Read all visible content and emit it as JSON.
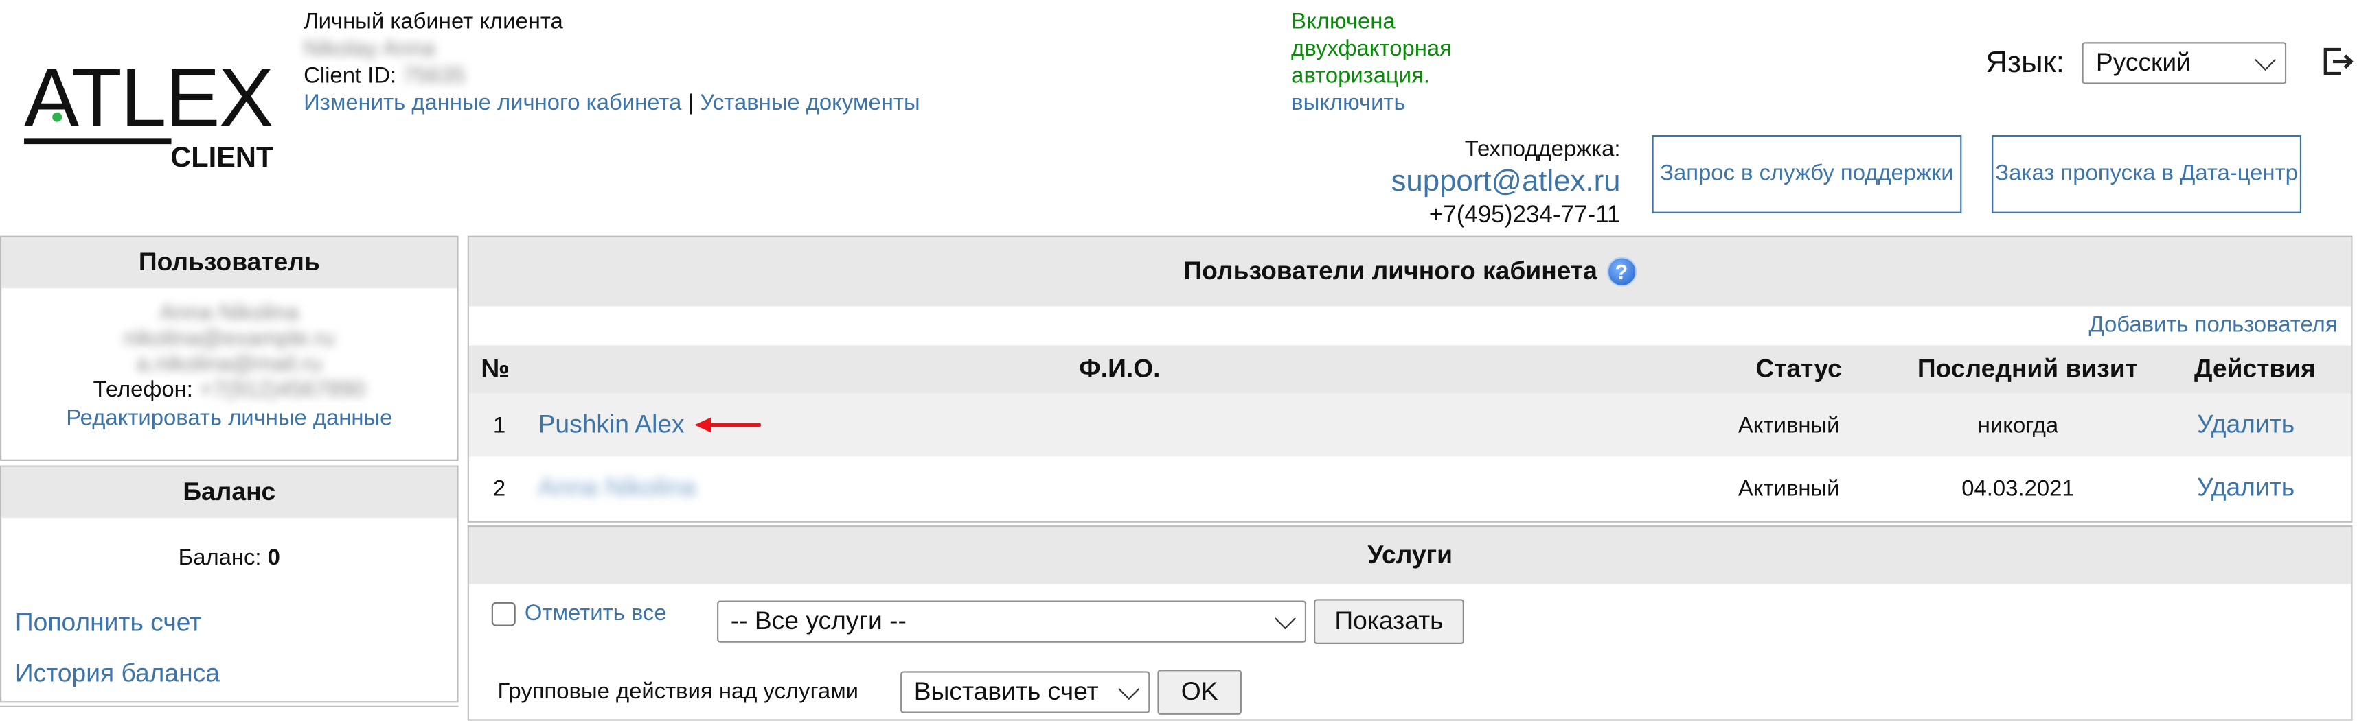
{
  "header": {
    "logo_main": "ATLEX",
    "logo_sub": "CLIENT",
    "cabinet_title": "Личный кабинет клиента",
    "client_name": "Nikolay Anna",
    "client_id_label": "Client ID:",
    "client_id_value": "75635",
    "edit_cabinet_link": "Изменить данные личного кабинета",
    "link_separator": "|",
    "statutory_docs_link": "Уставные документы",
    "twofa_line1": "Включена",
    "twofa_line2": "двухфакторная",
    "twofa_line3": "авторизация.",
    "twofa_disable_link": "выключить",
    "language_label": "Язык:",
    "language_value": "Русский",
    "support_label": "Техподдержка:",
    "support_email": "support@atlex.ru",
    "support_phone": "+7(495)234-77-11",
    "support_request_button": "Запрос в службу поддержки",
    "datacenter_pass_button": "Заказ пропуска в Дата-центр"
  },
  "user_panel": {
    "title": "Пользователь",
    "blurred_line1": "Anna Nikolina",
    "blurred_line2": "nikolina@example.ru",
    "blurred_line3": "a.nikolina@mail.ru",
    "phone_label": "Телефон:",
    "phone_value": "+7(912)4567890",
    "edit_link": "Редактировать личные данные"
  },
  "balance_panel": {
    "title": "Баланс",
    "balance_label": "Баланс:",
    "balance_value": "0",
    "topup_link": "Пополнить счет",
    "history_link": "История баланса"
  },
  "users_panel": {
    "title": "Пользователи личного кабинета",
    "help_glyph": "?",
    "add_user_link": "Добавить пользователя",
    "columns": {
      "num": "№",
      "name": "Ф.И.О.",
      "status": "Статус",
      "last_visit": "Последний визит",
      "actions": "Действия"
    },
    "rows": [
      {
        "num": "1",
        "name": "Pushkin Alex",
        "status": "Активный",
        "last_visit": "никогда",
        "action": "Удалить"
      },
      {
        "num": "2",
        "name": "Anna Nikolina",
        "status": "Активный",
        "last_visit": "04.03.2021",
        "action": "Удалить"
      }
    ]
  },
  "services_panel": {
    "title": "Услуги",
    "select_all_label": "Отметить все",
    "services_filter_value": "-- Все услуги --",
    "show_button": "Показать",
    "group_actions_label": "Групповые действия над услугами",
    "group_action_value": "Выставить счет",
    "ok_button": "OK"
  },
  "colors": {
    "link": "#3d74aa",
    "twofa_green": "#0a8a0a",
    "panel_header": "#e8e8e8",
    "arrow_red": "#e8141a"
  }
}
